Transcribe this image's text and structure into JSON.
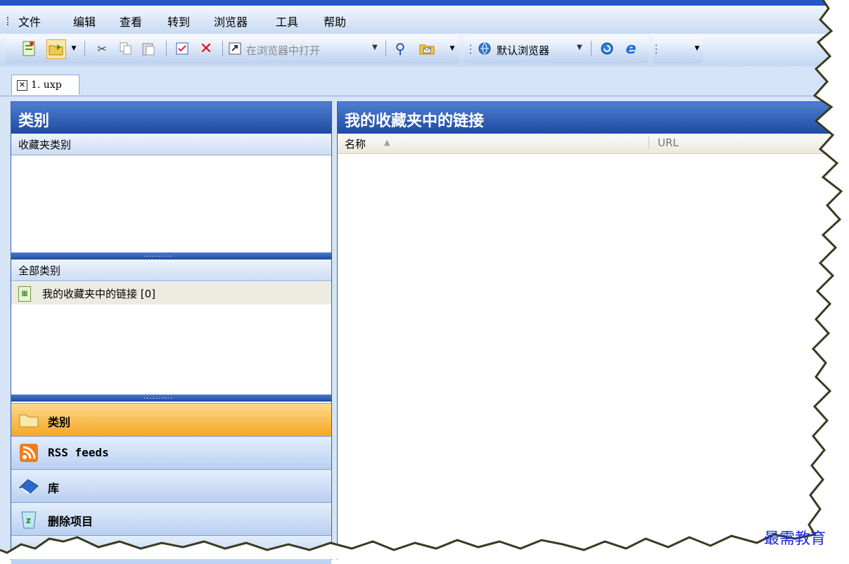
{
  "menu": {
    "items": [
      "文件",
      "编辑",
      "查看",
      "转到",
      "浏览器",
      "工具",
      "帮助"
    ]
  },
  "toolbar": {
    "open_in_browser_label": "在浏览器中打开",
    "default_browser_label": "默认浏览器"
  },
  "tabs": [
    {
      "label": "1. uxp"
    }
  ],
  "left_panel": {
    "title": "类别",
    "favorites_section": "收藏夹类别",
    "all_section": "全部类别",
    "category_item": "我的收藏夹中的链接  [0]",
    "nav": [
      {
        "label": "类别",
        "icon": "folder-icon"
      },
      {
        "label": "RSS feeds",
        "icon": "rss-icon"
      },
      {
        "label": "库",
        "icon": "book-icon"
      },
      {
        "label": "删除项目",
        "icon": "recycle-bin-icon"
      }
    ]
  },
  "right_panel": {
    "title": "我的收藏夹中的链接",
    "columns": [
      "名称",
      "URL"
    ]
  },
  "watermark": "最需教育",
  "colors": {
    "header_blue": "#1f4aa3",
    "active_nav": "#f4a724",
    "watermark": "#1b2ad6"
  }
}
